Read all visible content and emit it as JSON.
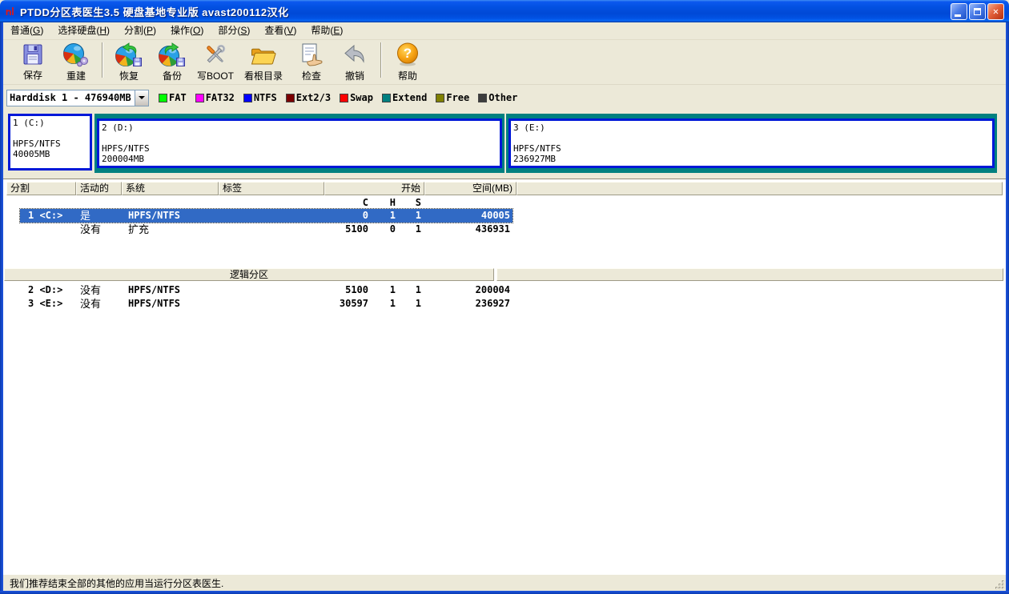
{
  "window": {
    "title": "PTDD分区表医生3.5 硬盘基地专业版 avast200112汉化"
  },
  "menu_bar": {
    "items": [
      {
        "prefix": "普通(",
        "key": "G",
        "suffix": ")"
      },
      {
        "prefix": "选择硬盘(",
        "key": "H",
        "suffix": ")"
      },
      {
        "prefix": "分割(",
        "key": "P",
        "suffix": ")"
      },
      {
        "prefix": "操作(",
        "key": "O",
        "suffix": ")"
      },
      {
        "prefix": "部分(",
        "key": "S",
        "suffix": ")"
      },
      {
        "prefix": "查看(",
        "key": "V",
        "suffix": ")"
      },
      {
        "prefix": "帮助(",
        "key": "E",
        "suffix": ")"
      }
    ]
  },
  "toolbar": {
    "buttons": [
      {
        "label": "保存",
        "icon": "floppy-save-icon"
      },
      {
        "label": "重建",
        "icon": "pie-gear-rebuild-icon"
      },
      {
        "label": "恢复",
        "icon": "pie-arrow-left-restore-icon"
      },
      {
        "label": "备份",
        "icon": "pie-arrow-right-backup-icon"
      },
      {
        "label": "写BOOT",
        "icon": "crossed-tools-icon"
      },
      {
        "label": "看根目录",
        "icon": "open-folder-icon"
      },
      {
        "label": "检查",
        "icon": "document-hand-check-icon"
      },
      {
        "label": "撤销",
        "icon": "undo-arrow-icon"
      },
      {
        "label": "帮助",
        "icon": "help-question-icon"
      }
    ]
  },
  "disk_selector": {
    "value": "Harddisk 1 - 476940MB"
  },
  "legend": {
    "items": [
      {
        "label": "FAT",
        "color": "#00ff00"
      },
      {
        "label": "FAT32",
        "color": "#ff00ff"
      },
      {
        "label": "NTFS",
        "color": "#0000ff"
      },
      {
        "label": "Ext2/3",
        "color": "#7b0000"
      },
      {
        "label": "Swap",
        "color": "#ff0000"
      },
      {
        "label": "Extend",
        "color": "#008080"
      },
      {
        "label": "Free",
        "color": "#808000"
      },
      {
        "label": "Other",
        "color": "#3d3d3d"
      }
    ]
  },
  "partition_map": {
    "primary": {
      "name": "1 (C:)",
      "fs": "HPFS/NTFS",
      "size": "40005MB",
      "border_color": "#0018d8"
    },
    "logical": [
      {
        "name": "2 (D:)",
        "fs": "HPFS/NTFS",
        "size": "200004MB",
        "wrapper_color": "#008080"
      },
      {
        "name": "3 (E:)",
        "fs": "HPFS/NTFS",
        "size": "236927MB",
        "wrapper_color": "#008080"
      }
    ]
  },
  "table": {
    "headers": {
      "partition": "分割",
      "active": "活动的",
      "system": "系统",
      "label": "标签",
      "start": "开始",
      "space": "空间(MB)"
    },
    "sub_headers": {
      "c": "C",
      "h": "H",
      "s": "S"
    },
    "primary_rows": [
      {
        "name": "1 <C:>",
        "active": "是",
        "system": "HPFS/NTFS",
        "label": "",
        "c": "0",
        "h": "1",
        "s": "1",
        "space": "40005"
      },
      {
        "name": "",
        "active": "没有",
        "system": "扩充",
        "label": "",
        "c": "5100",
        "h": "0",
        "s": "1",
        "space": "436931"
      }
    ],
    "logical_section_title": "逻辑分区",
    "logical_rows": [
      {
        "name": "2 <D:>",
        "active": "没有",
        "system": "HPFS/NTFS",
        "label": "",
        "c": "5100",
        "h": "1",
        "s": "1",
        "space": "200004"
      },
      {
        "name": "3 <E:>",
        "active": "没有",
        "system": "HPFS/NTFS",
        "label": "",
        "c": "30597",
        "h": "1",
        "s": "1",
        "space": "236927"
      }
    ]
  },
  "status_bar": {
    "message": "我们推荐结束全部的其他的应用当运行分区表医生."
  },
  "colors": {
    "selection": "#316ac5",
    "face": "#ece9d8",
    "window_border": "#0a3bb0",
    "extend_teal": "#008080",
    "partition_blue": "#0018d8"
  }
}
